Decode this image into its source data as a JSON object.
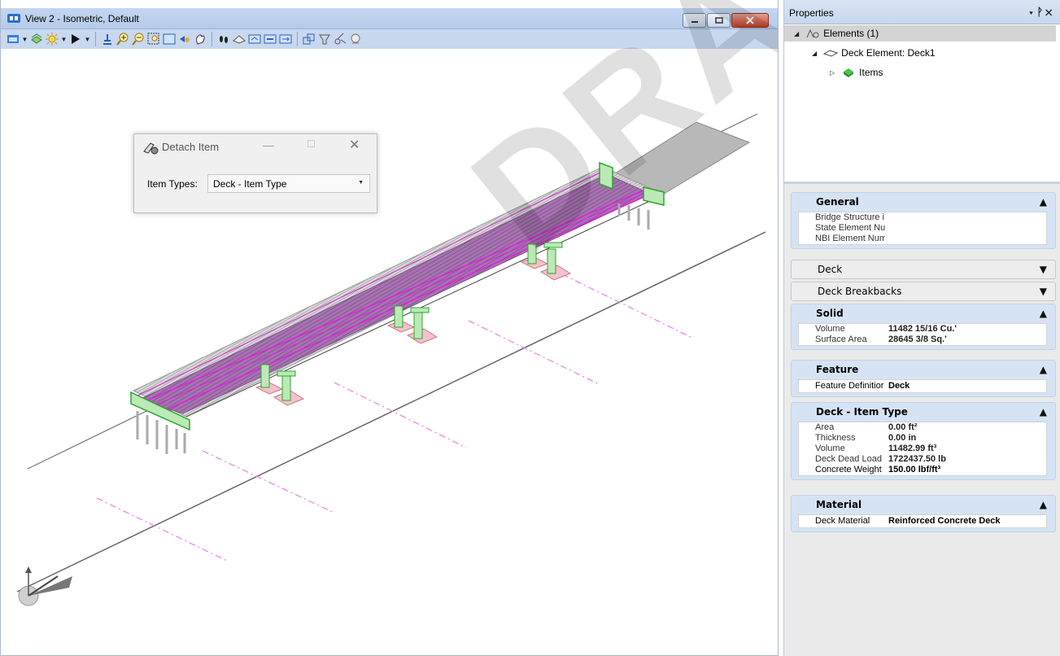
{
  "view": {
    "title": "View 2 - Isometric, Default",
    "toolbar_icons": [
      "view-attributes-icon",
      "level-display-icon",
      "display-style-icon",
      "shading-icon",
      "update-view-icon",
      "zoom-in-icon",
      "zoom-out-icon",
      "window-area-icon",
      "fit-view-icon",
      "rotate-view-icon",
      "pan-view-icon",
      "walk-icon",
      "view-previous-icon",
      "view-next-icon",
      "copy-view-icon",
      "clip-volume-icon",
      "clip-mask-icon",
      "camera-icon",
      "toggle-icon"
    ]
  },
  "detach_dialog": {
    "title": "Detach Item",
    "item_types_label": "Item Types:",
    "item_types_value": "Deck - Item Type"
  },
  "watermark": "DRAFT",
  "properties": {
    "title": "Properties",
    "tree": [
      {
        "label": "Elements (1)",
        "icon": "elements-icon",
        "level": 0,
        "expanded": true,
        "selected": true
      },
      {
        "label": "Deck Element: Deck1",
        "icon": "deck-element-icon",
        "level": 1,
        "expanded": true,
        "selected": false
      },
      {
        "label": "Items",
        "icon": "items-icon",
        "level": 2,
        "expanded": false,
        "selected": false
      }
    ],
    "sections": {
      "general": {
        "title": "General",
        "rows": [
          {
            "key": "Bridge Structure i",
            "value": ""
          },
          {
            "key": "State Element Nu",
            "value": ""
          },
          {
            "key": "NBI Element Num",
            "value": ""
          }
        ]
      },
      "deck": {
        "title": "Deck"
      },
      "deck_breakbacks": {
        "title": "Deck Breakbacks"
      },
      "solid": {
        "title": "Solid",
        "rows": [
          {
            "key": "Volume",
            "value": "11482 15/16 Cu.'"
          },
          {
            "key": "Surface Area",
            "value": "28645 3/8 Sq.'"
          }
        ]
      },
      "feature": {
        "title": "Feature",
        "rows": [
          {
            "key": "Feature Definitior",
            "value": "Deck"
          }
        ]
      },
      "deck_item_type": {
        "title": "Deck - Item Type",
        "rows": [
          {
            "key": "Area",
            "value": "0.00 ft²"
          },
          {
            "key": "Thickness",
            "value": "0.00 in"
          },
          {
            "key": "Volume",
            "value": "11482.99 ft³"
          },
          {
            "key": "Deck Dead Load",
            "value": "1722437.50 lb"
          },
          {
            "key": "Concrete Weight",
            "value": "150.00 lbf/ft³"
          }
        ]
      },
      "material": {
        "title": "Material",
        "rows": [
          {
            "key": "Deck Material",
            "value": "Reinforced Concrete Deck"
          }
        ]
      }
    }
  },
  "colors": {
    "deck": "#9b63a8",
    "deck_edge": "#e020e0",
    "footing": "#f4c0d0",
    "pier": "#3fbf3f",
    "section_header": "#d6e3f4"
  }
}
